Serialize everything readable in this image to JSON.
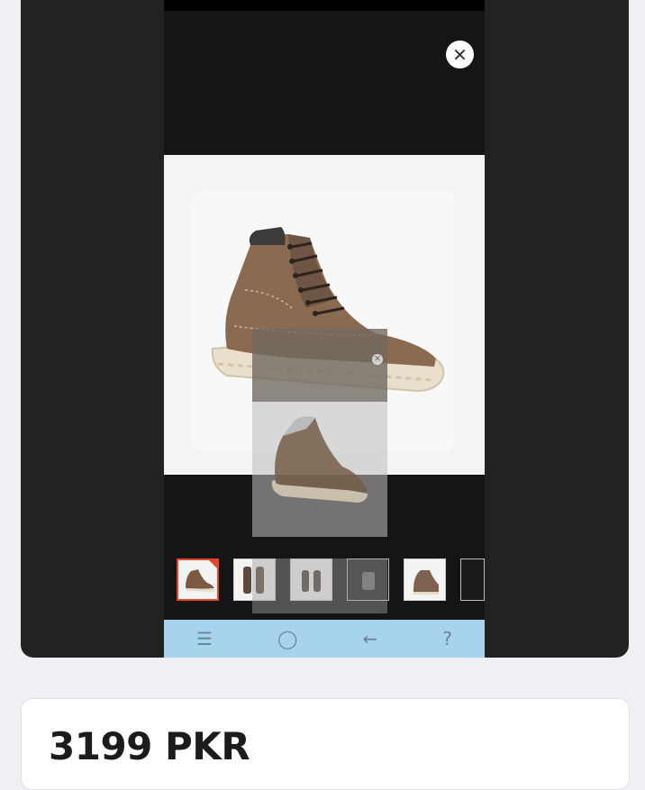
{
  "viewer": {
    "close_icon": "close-icon",
    "images": [
      "boot-side",
      "boot-pair",
      "boot-pair-back",
      "boot-sole",
      "boot-detail",
      "boot-extra"
    ],
    "active_index": 0
  },
  "navbar": {
    "icons": [
      "menu-icon",
      "home-icon",
      "back-icon",
      "help-icon"
    ]
  },
  "product": {
    "price": "3199 PKR"
  },
  "colors": {
    "accent": "#e4472a",
    "navbar": "#a7d4ec",
    "card_dark": "#222222"
  }
}
